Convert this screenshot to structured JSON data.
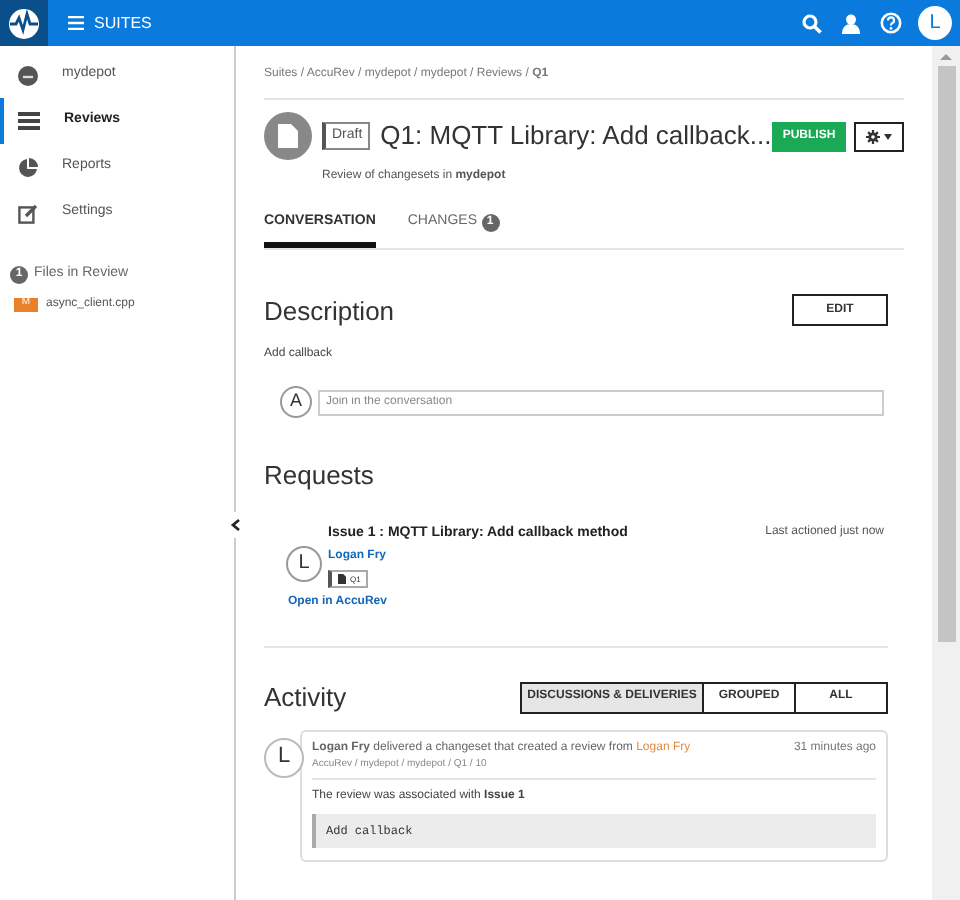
{
  "top_bar": {
    "menu_label": "SUITES",
    "avatar": "L"
  },
  "sidebar": {
    "items": [
      {
        "label": "mydepot",
        "kind": "depot",
        "selected": false
      },
      {
        "label": "Reviews",
        "kind": "reviews",
        "selected": true
      },
      {
        "label": "Reports",
        "kind": "reports",
        "selected": false
      },
      {
        "label": "Settings",
        "kind": "settings",
        "selected": false
      }
    ],
    "files_count": "1",
    "files_label": "Files in Review",
    "files": [
      {
        "badge": "M",
        "name": "async_client.cpp"
      }
    ]
  },
  "breadcrumb": "Suites / AccuRev / mydepot / mydepot / Reviews / **Q1**",
  "review": {
    "status": "Draft",
    "title": "Q1: MQTT Library: Add callback...",
    "publish": "PUBLISH",
    "subtitle": "Review of changesets in **mydepot**"
  },
  "tabs": [
    {
      "label": "CONVERSATION",
      "selected": true
    },
    {
      "label": "CHANGES",
      "count": "1",
      "selected": false
    }
  ],
  "description": {
    "heading": "Description",
    "edit": "EDIT",
    "text": "Add callback",
    "avatar": "A",
    "placeholder": "Join in the conversation"
  },
  "requests": {
    "heading": "Requests",
    "items": [
      {
        "avatar": "L",
        "title": "Issue 1 : MQTT Library: Add callback method",
        "author": "Logan Fry",
        "tag": "Q1",
        "time": "Last actioned just now"
      }
    ],
    "link": "Open in AccuRev"
  },
  "activity": {
    "heading": "Activity",
    "filters": [
      {
        "label": "DISCUSSIONS & DELIVERIES",
        "selected": true
      },
      {
        "label": "GROUPED",
        "selected": false
      },
      {
        "label": "ALL",
        "selected": false
      }
    ],
    "entries": [
      {
        "avatar": "L",
        "text": "**Logan Fry** delivered a changeset that created a review from",
        "author_link": "Logan Fry",
        "time": "31 minutes ago",
        "path": "AccuRev / mydepot / mydepot / Q1 / 10",
        "note": "The review was associated with **Issue 1**",
        "code": "Add callback"
      }
    ]
  }
}
